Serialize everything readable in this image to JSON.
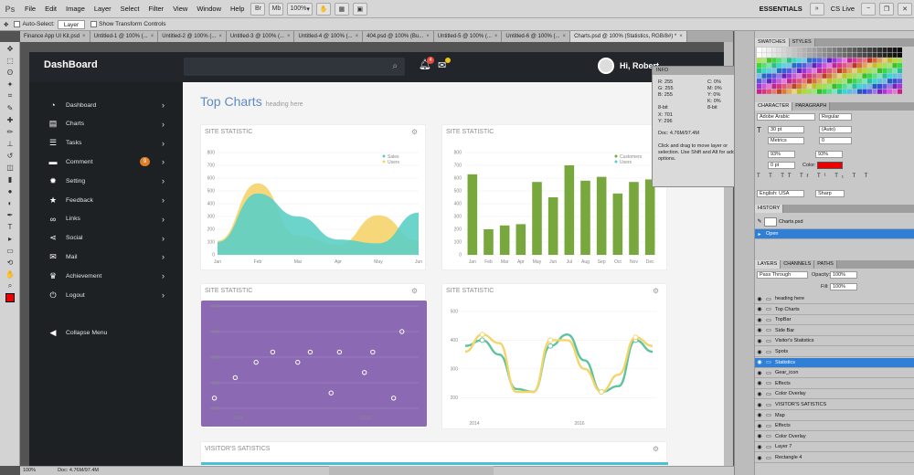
{
  "app": {
    "menu": [
      "File",
      "Edit",
      "Image",
      "Layer",
      "Select",
      "Filter",
      "View",
      "Window",
      "Help"
    ],
    "zoom": "100%",
    "workspace": "ESSENTIALS",
    "cs_live": "CS Live"
  },
  "options_bar": {
    "auto_select_label": "Auto-Select:",
    "auto_select_value": "Layer",
    "transform_label": "Show Transform Controls"
  },
  "doc_tabs": [
    {
      "label": "Finance App UI Kit.psd"
    },
    {
      "label": "Untitled-1 @ 100% (..."
    },
    {
      "label": "Untitled-2 @ 100% (..."
    },
    {
      "label": "Untitled-3 @ 100% (..."
    },
    {
      "label": "Untitled-4 @ 100% (..."
    },
    {
      "label": "404.psd @ 100% (Bu..."
    },
    {
      "label": "Untitled-5 @ 100% (..."
    },
    {
      "label": "Untitled-6 @ 100% (..."
    },
    {
      "label": "Charts.psd @ 100% (Statistics, RGB/8#) *"
    }
  ],
  "dashboard": {
    "brand": "DashBoard",
    "notif_count": "4",
    "user_greeting": "Hi, Robert",
    "title": "Top Charts",
    "subtitle": "heading here",
    "sidebar": [
      {
        "label": "Dashboard",
        "icon": "dashboard-icon",
        "glyph": "◔"
      },
      {
        "label": "Charts",
        "icon": "chat-icon",
        "glyph": "▤"
      },
      {
        "label": "Tasks",
        "icon": "list-icon",
        "glyph": "☰"
      },
      {
        "label": "Comment",
        "icon": "comment-icon",
        "glyph": "▬",
        "badge": "9"
      },
      {
        "label": "Setting",
        "icon": "gear-icon",
        "glyph": "✹"
      },
      {
        "label": "Feedback",
        "icon": "star-icon",
        "glyph": "★"
      },
      {
        "label": "Links",
        "icon": "link-icon",
        "glyph": "∞"
      },
      {
        "label": "Social",
        "icon": "share-icon",
        "glyph": "⋖"
      },
      {
        "label": "Mail",
        "icon": "mail-icon",
        "glyph": "✉"
      },
      {
        "label": "Achievement",
        "icon": "trophy-icon",
        "glyph": "♛"
      },
      {
        "label": "Logout",
        "icon": "power-icon",
        "glyph": "⏻"
      }
    ],
    "collapse_label": "Collapse Menu",
    "cards": {
      "c1_title": "SITE STATISTIC",
      "c2_title": "SITE STATISTIC",
      "c3_title": "SITE STATISTIC",
      "c4_title": "SITE STATISTIC",
      "c5_title": "VISITOR'S SATISTICS"
    }
  },
  "chart_data": [
    {
      "type": "area",
      "title": "SITE STATISTIC",
      "categories": [
        "Jan",
        "Feb",
        "Mar",
        "Apr",
        "May",
        "Jun"
      ],
      "ylim": [
        0,
        800
      ],
      "yticks": [
        0,
        100,
        200,
        300,
        400,
        500,
        600,
        700,
        800
      ],
      "series": [
        {
          "name": "Sales",
          "color": "#5ccfc5",
          "values": [
            100,
            480,
            300,
            120,
            90,
            330
          ]
        },
        {
          "name": "Users",
          "color": "#f5d36a",
          "values": [
            110,
            560,
            150,
            80,
            310,
            110
          ]
        }
      ],
      "legend": "top-right"
    },
    {
      "type": "bar",
      "title": "SITE STATISTIC",
      "categories": [
        "Jan",
        "Feb",
        "Mar",
        "Apr",
        "May",
        "Jun",
        "Jul",
        "Aug",
        "Sep",
        "Oct",
        "Nov",
        "Dec"
      ],
      "ylim": [
        0,
        800
      ],
      "yticks": [
        0,
        100,
        200,
        300,
        400,
        500,
        600,
        700,
        800
      ],
      "series": [
        {
          "name": "Customers",
          "color": "#78a83d",
          "values": [
            630,
            200,
            230,
            240,
            570,
            450,
            700,
            580,
            610,
            480,
            570,
            590
          ]
        },
        {
          "name": "Users",
          "color": "#5ccfc5",
          "values": []
        }
      ],
      "legend": "top-right"
    },
    {
      "type": "scatter",
      "title": "SITE STATISTIC",
      "ylim": [
        0,
        500
      ],
      "xticks": [
        "2014",
        "2016"
      ],
      "ylabels": [
        "500",
        "400",
        "300",
        "200",
        "100"
      ],
      "series": [
        {
          "name": "",
          "color": "#ffffff",
          "points": [
            [
              0.02,
              0.1
            ],
            [
              0.12,
              0.3
            ],
            [
              0.22,
              0.45
            ],
            [
              0.3,
              0.55
            ],
            [
              0.42,
              0.45
            ],
            [
              0.48,
              0.55
            ],
            [
              0.58,
              0.15
            ],
            [
              0.62,
              0.55
            ],
            [
              0.74,
              0.35
            ],
            [
              0.78,
              0.55
            ],
            [
              0.88,
              0.1
            ],
            [
              0.92,
              0.75
            ]
          ]
        }
      ]
    },
    {
      "type": "line",
      "title": "SITE STATISTIC",
      "ylim": [
        0,
        500
      ],
      "yticks": [
        200,
        300,
        400,
        500
      ],
      "xticks": [
        "2014",
        "2016"
      ],
      "series": [
        {
          "name": "",
          "color": "#5cc49b",
          "values": [
            380,
            400,
            350,
            230,
            220,
            380,
            420,
            330,
            220,
            240,
            400,
            360
          ]
        },
        {
          "name": "",
          "color": "#f3d56b",
          "values": [
            360,
            420,
            390,
            220,
            220,
            400,
            400,
            300,
            220,
            280,
            410,
            380
          ]
        }
      ]
    }
  ],
  "info_panel": {
    "title": "INFO",
    "r": "255",
    "g": "255",
    "b": "255",
    "c": "0%",
    "m": "0%",
    "y": "0%",
    "k": "0%",
    "bit1": "8-bit",
    "bit2": "8-bit",
    "x": "701",
    "yv": "296",
    "doc": "Doc: 4.76M/97.4M",
    "hint": "Click and drag to move layer or selection. Use Shift and Alt for additional options."
  },
  "character": {
    "font": "Adobe Arabic",
    "style": "Regular",
    "size": "30 pt",
    "leading": "(Auto)",
    "kerning": "Metrics",
    "tracking": "0",
    "vscale": "93%",
    "hscale": "93%",
    "baseline": "0 pt",
    "color_label": "Color:",
    "lang": "English: USA",
    "aa": "Sharp"
  },
  "history": {
    "doc": "Charts.psd",
    "step": "Open"
  },
  "layers": {
    "blend": "Pass Through",
    "opacity_label": "Opacity:",
    "opacity": "100%",
    "fill_label": "Fill:",
    "fill": "100%",
    "rows": [
      {
        "label": "heading here"
      },
      {
        "label": "Top Charts"
      },
      {
        "label": "TopBar"
      },
      {
        "label": "Side Bar"
      },
      {
        "label": "Visitor's Statistics"
      },
      {
        "label": "Spots"
      },
      {
        "label": "Statistics"
      },
      {
        "label": "Gear_icon"
      },
      {
        "label": "Effects"
      },
      {
        "label": "Color Overlay"
      },
      {
        "label": "VISITOR'S SATISTICS"
      },
      {
        "label": "Map"
      },
      {
        "label": "Effects"
      },
      {
        "label": "Color Overlay"
      },
      {
        "label": "Layer 7"
      },
      {
        "label": "Rectangle 4"
      }
    ]
  },
  "panels": {
    "swatches": "SWATCHES",
    "styles": "STYLES",
    "character": "CHARACTER",
    "paragraph": "PARAGRAPH",
    "history": "HISTORY",
    "layers": "LAYERS",
    "channels": "CHANNELS",
    "paths": "PATHS"
  },
  "status": {
    "zoom": "100%",
    "doc": "Doc: 4.76M/97.4M"
  }
}
